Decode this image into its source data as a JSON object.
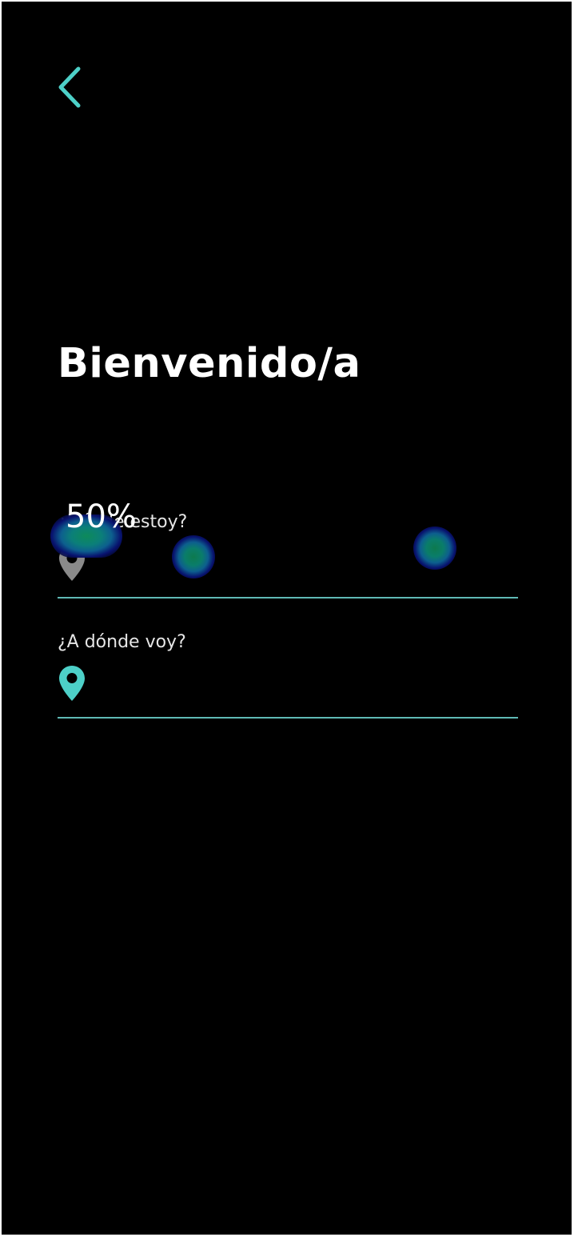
{
  "header": {
    "back_icon": "chevron-left-icon"
  },
  "title": "Bienvenido/a",
  "origin_field": {
    "label": "¿Dónde estoy?",
    "icon": "map-pin-icon",
    "value": ""
  },
  "destination_field": {
    "label": "¿A dónde voy?",
    "icon": "map-pin-icon",
    "value": ""
  },
  "heatmap_overlay": {
    "label": "50%"
  },
  "colors": {
    "background": "#000000",
    "accent": "#4dd0c8",
    "underline": "#5fb9b5",
    "inactive_pin": "#8a8a8a",
    "text": "#ffffff"
  }
}
